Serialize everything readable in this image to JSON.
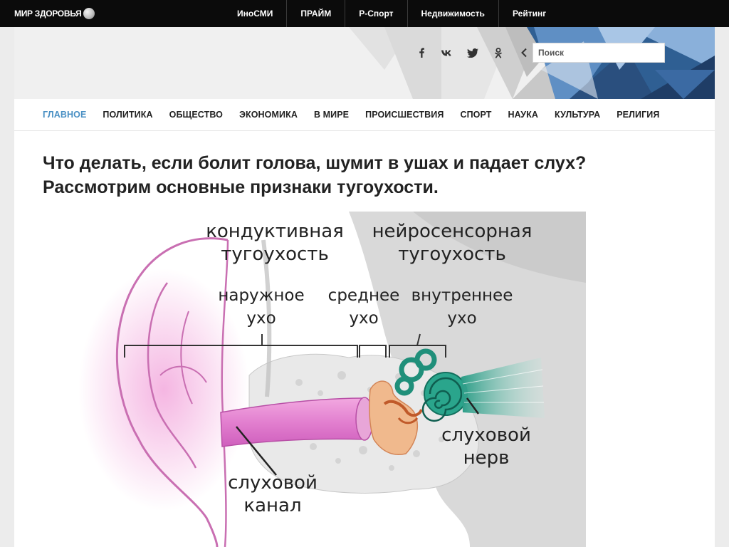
{
  "topbar": {
    "logo_text": "МИР ЗДОРОВЬЯ",
    "links": [
      "ИноСМИ",
      "ПРАЙМ",
      "Р-Спорт",
      "Недвижимость",
      "Рейтинг"
    ]
  },
  "header": {
    "social_icons": [
      "facebook-icon",
      "vk-icon",
      "twitter-icon",
      "odnoklassniki-icon",
      "share-chevron-icon"
    ],
    "search_placeholder": "Поиск"
  },
  "nav": {
    "items": [
      "ГЛАВНОЕ",
      "ПОЛИТИКА",
      "ОБЩЕСТВО",
      "ЭКОНОМИКА",
      "В МИРЕ",
      "ПРОИСШЕСТВИЯ",
      "СПОРТ",
      "НАУКА",
      "КУЛЬТУРА",
      "РЕЛИГИЯ"
    ],
    "active": "ГЛАВНОЕ"
  },
  "article": {
    "title": "Что делать, если болит голова, шумит в ушах и падает слух? Рассмотрим основные признаки тугоухости.",
    "figure_labels": {
      "conductive_1": "кондуктивная",
      "conductive_2": "тугоухость",
      "neuro_1": "нейросенсорная",
      "neuro_2": "тугоухость",
      "outer_1": "наружное",
      "outer_2": "ухо",
      "middle_1": "среднее",
      "middle_2": "ухо",
      "inner_1": "внутреннее",
      "inner_2": "ухо",
      "nerve_1": "слуховой",
      "nerve_2": "нерв",
      "canal_1": "слуховой",
      "canal_2": "канал"
    }
  },
  "colors": {
    "accent": "#4a90c4",
    "topbar": "#0b0b0b",
    "canal_pink": "#e58fd0",
    "cochlea_teal": "#1f8f7a"
  }
}
